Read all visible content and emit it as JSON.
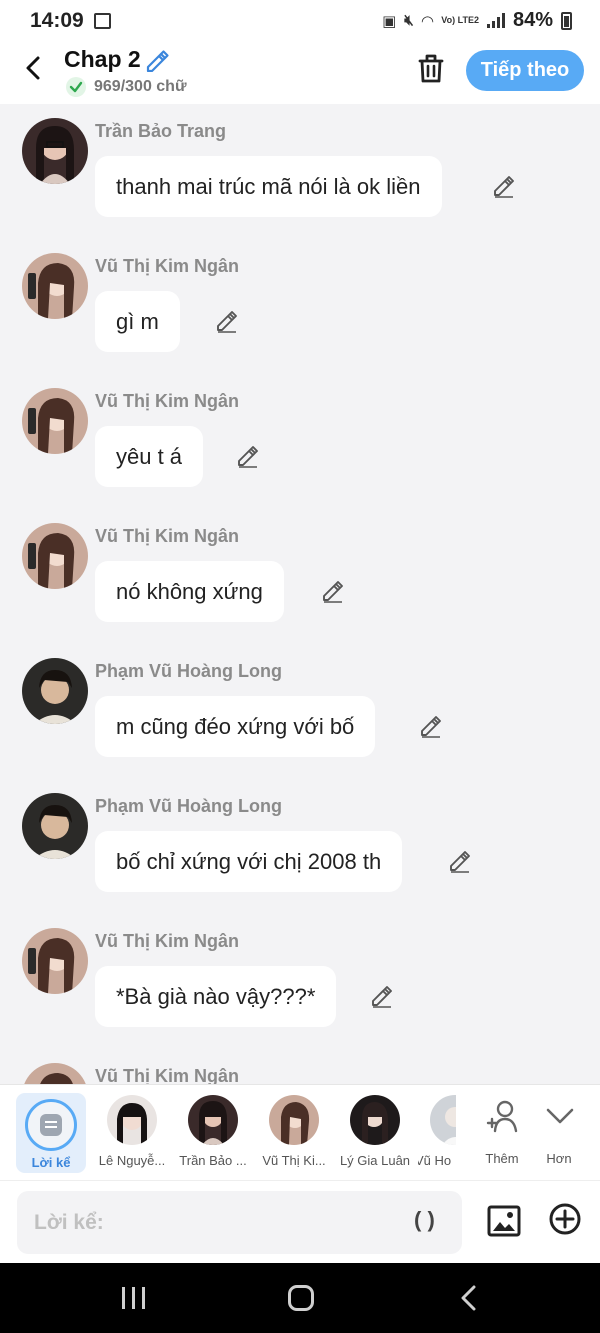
{
  "status_bar": {
    "time": "14:09",
    "network": "Vo) LTE2",
    "battery": "84%"
  },
  "header": {
    "title": "Chap 2",
    "word_count": "969/300 chữ",
    "next_button": "Tiếp theo"
  },
  "messages": [
    {
      "sender": "Trần Bảo Trang",
      "text": "thanh mai trúc mã nói là ok liền"
    },
    {
      "sender": "Vũ Thị Kim Ngân",
      "text": "gì m"
    },
    {
      "sender": "Vũ Thị Kim Ngân",
      "text": "yêu t á"
    },
    {
      "sender": "Vũ Thị Kim Ngân",
      "text": "nó không xứng"
    },
    {
      "sender": "Phạm Vũ Hoàng Long",
      "text": "m cũng đéo xứng với bố"
    },
    {
      "sender": "Phạm Vũ Hoàng Long",
      "text": "bố chỉ xứng với chị 2008 th"
    },
    {
      "sender": "Vũ Thị Kim Ngân",
      "text": "*Bà già nào vậy???*"
    },
    {
      "sender": "Vũ Thị Kim Ngân",
      "text": ""
    }
  ],
  "characters": {
    "narrator": "Lời kể",
    "list": [
      "Lê Nguyễ...",
      "Trần Bảo ...",
      "Vũ Thị Ki...",
      "Lý Gia Luân",
      "Vũ Ho"
    ],
    "add_label": "Thêm",
    "more_label": "Hơn"
  },
  "input": {
    "placeholder": "Lời kể:",
    "paren": "( )"
  },
  "colors": {
    "accent": "#58aaf5",
    "background": "#f3f3f5",
    "bubble": "#ffffff"
  }
}
